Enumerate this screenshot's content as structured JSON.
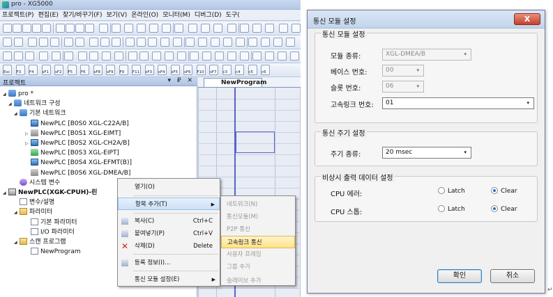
{
  "app": {
    "title": "pro - XG5000",
    "menu": [
      "프로젝트(P)",
      "편집(E)",
      "찾기/바꾸기(F)",
      "보기(V)",
      "온라인(O)",
      "모니터(M)",
      "디버그(D)",
      "도구("
    ],
    "fkeys": [
      "Esc",
      "F3",
      "F4",
      "sF1",
      "sF2",
      "F5",
      "F6",
      "sF8",
      "sF9",
      "F9",
      "F11",
      "sF3",
      "sF4",
      "sF5",
      "sF6",
      "F10",
      "sF7",
      "c3",
      "c4",
      "c5",
      "c6"
    ]
  },
  "project_panel": {
    "title": "프로젝트",
    "controls": "▾ ₽ ✕",
    "tree": [
      {
        "label": "pro *",
        "arrow": "◢",
        "icon": "project-icon",
        "cls": "ic-net"
      },
      {
        "label": "네트워크 구성",
        "arrow": "◢",
        "icon": "network-config-icon",
        "cls": "ic-net"
      },
      {
        "label": "기본 네트워크",
        "arrow": "◢",
        "icon": "basic-network-icon",
        "cls": "ic-net"
      },
      {
        "label": "NewPLC [B0S0 XGL-C22A/B]",
        "arrow": "",
        "icon": "plc-module-icon",
        "cls": "ic-plc"
      },
      {
        "label": "NewPLC [B0S1 XGL-EIMT]",
        "arrow": "▷",
        "icon": "ethernet-module-icon",
        "cls": "ic-gray"
      },
      {
        "label": "NewPLC [B0S2 XGL-CH2A/B]",
        "arrow": "▷",
        "icon": "plc-module-icon",
        "cls": "ic-plc"
      },
      {
        "label": "NewPLC [B0S3 XGL-EIPT]",
        "arrow": "",
        "icon": "eip-module-icon",
        "cls": "ic-green"
      },
      {
        "label": "NewPLC [B0S4 XGL-EFMT(B)]",
        "arrow": "",
        "icon": "plc-module-icon",
        "cls": "ic-plc"
      },
      {
        "label": "NewPLC [B0S6 XGL-DMEA/B]",
        "arrow": "",
        "icon": "dnet-module-icon",
        "cls": "ic-gray"
      },
      {
        "label": "시스템 변수",
        "arrow": "",
        "icon": "system-variable-icon",
        "cls": "ic-purple"
      },
      {
        "label": "NewPLC(XGK-CPUH)-린",
        "arrow": "◢",
        "icon": "cpu-icon",
        "cls": "ic-cpu",
        "bold": true
      },
      {
        "label": "변수/설명",
        "arrow": "",
        "icon": "variable-icon",
        "cls": "ic-doc"
      },
      {
        "label": "파라미터",
        "arrow": "◢",
        "icon": "parameter-folder-icon",
        "cls": "ic-folder"
      },
      {
        "label": "기본 파라미터",
        "arrow": "",
        "icon": "basic-parameter-icon",
        "cls": "ic-doc"
      },
      {
        "label": "I/O 파라미터",
        "arrow": "",
        "icon": "io-parameter-icon",
        "cls": "ic-doc"
      },
      {
        "label": "스캔 프로그램",
        "arrow": "◢",
        "icon": "scan-program-icon",
        "cls": "ic-folder"
      },
      {
        "label": "NewProgram",
        "arrow": "",
        "icon": "program-icon",
        "cls": "ic-doc"
      }
    ]
  },
  "editor": {
    "tab_label": "NewProgram",
    "tab_close": "✕"
  },
  "context_menu": {
    "items": [
      {
        "label": "열기(O)",
        "shortcut": "",
        "icon": "",
        "submenu": false,
        "highlight": false
      },
      {
        "label": "항목 추가(T)",
        "shortcut": "",
        "icon": "",
        "submenu": true,
        "highlight": true
      },
      {
        "label": "복사(C)",
        "shortcut": "Ctrl+C",
        "icon": "copy-icon",
        "submenu": false,
        "highlight": false
      },
      {
        "label": "붙여넣기(P)",
        "shortcut": "Ctrl+V",
        "icon": "paste-icon",
        "submenu": false,
        "highlight": false
      },
      {
        "label": "삭제(D)",
        "shortcut": "Delete",
        "icon": "delete-icon",
        "submenu": false,
        "highlight": false
      },
      {
        "label": "등록 정보(I)...",
        "shortcut": "",
        "icon": "properties-icon",
        "submenu": false,
        "highlight": false
      },
      {
        "label": "통신 모듈 설정(E)",
        "shortcut": "",
        "icon": "",
        "submenu": true,
        "highlight": false
      }
    ],
    "arrow": "▶"
  },
  "sub_menu": {
    "items": [
      {
        "label": "네트워크(N)",
        "enabled": false,
        "highlight": false
      },
      {
        "label": "통신모듈(M)",
        "enabled": false,
        "highlight": false
      },
      {
        "label": "P2P 통신",
        "enabled": false,
        "highlight": false
      },
      {
        "label": "고속링크 통신",
        "enabled": true,
        "highlight": true
      },
      {
        "label": "사용자 프레임",
        "enabled": false,
        "highlight": false
      },
      {
        "label": "그룹 추가",
        "enabled": false,
        "highlight": false
      },
      {
        "label": "슬레이브 추가",
        "enabled": false,
        "highlight": false
      }
    ]
  },
  "dialog": {
    "title": "통신 모듈 설정",
    "close_label": "X",
    "group1": {
      "title": "통신 모듈 설정",
      "module_type_label": "모듈 종류:",
      "module_type_value": "XGL-DMEA/B",
      "base_label": "베이스 번호:",
      "base_value": "00",
      "slot_label": "슬롯 번호:",
      "slot_value": "06",
      "hslink_label": "고속링크 번호:",
      "hslink_value": "01"
    },
    "group2": {
      "title": "통신 주기 설정",
      "period_label": "주기 종류:",
      "period_value": "20 msec"
    },
    "group3": {
      "title": "비상시 출력 데이터 설정",
      "cpu_error_label": "CPU 에러:",
      "cpu_stop_label": "CPU 스톱:",
      "latch_label": "Latch",
      "clear_label": "Clear"
    },
    "ok_label": "확인",
    "cancel_label": "취소",
    "caret": "▾"
  },
  "page_mark": "↵"
}
